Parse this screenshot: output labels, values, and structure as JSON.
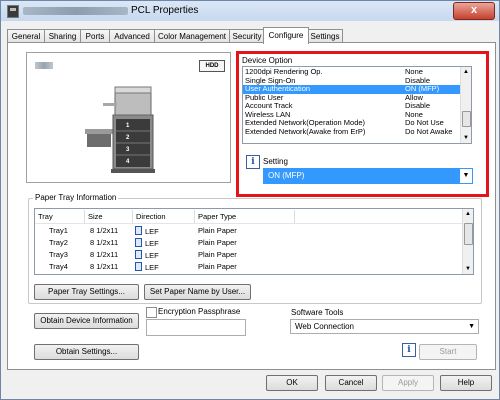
{
  "window": {
    "title": "PCL Properties",
    "close_glyph": "x"
  },
  "tabs": [
    {
      "label": "General"
    },
    {
      "label": "Sharing"
    },
    {
      "label": "Ports"
    },
    {
      "label": "Advanced"
    },
    {
      "label": "Color Management"
    },
    {
      "label": "Security"
    },
    {
      "label": "Configure"
    },
    {
      "label": "Settings"
    }
  ],
  "printer": {
    "hdd_label": "HDD",
    "tray_numbers": [
      "1",
      "2",
      "3",
      "4"
    ]
  },
  "device_option": {
    "title": "Device Option",
    "items": [
      {
        "name": "1200dpi Rendering Op.",
        "value": "None"
      },
      {
        "name": "Single Sign-On",
        "value": "Disable"
      },
      {
        "name": "User Authentication",
        "value": "ON (MFP)",
        "selected": true
      },
      {
        "name": "Public User",
        "value": "Allow"
      },
      {
        "name": "Account Track",
        "value": "Disable"
      },
      {
        "name": "Wireless LAN",
        "value": "None"
      },
      {
        "name": "Extended Network(Operation Mode)",
        "value": "Do Not Use"
      },
      {
        "name": "Extended Network(Awake from ErP)",
        "value": "Do Not Awake"
      }
    ],
    "setting_label": "Setting",
    "setting_value": "ON (MFP)",
    "info_glyph": "i"
  },
  "paper_tray": {
    "title": "Paper Tray Information",
    "columns": [
      "Tray",
      "Size",
      "Direction",
      "Paper Type"
    ],
    "rows": [
      {
        "tray": "Tray1",
        "size": "8 1/2x11",
        "direction": "LEF",
        "type": "Plain Paper"
      },
      {
        "tray": "Tray2",
        "size": "8 1/2x11",
        "direction": "LEF",
        "type": "Plain Paper"
      },
      {
        "tray": "Tray3",
        "size": "8 1/2x11",
        "direction": "LEF",
        "type": "Plain Paper"
      },
      {
        "tray": "Tray4",
        "size": "8 1/2x11",
        "direction": "LEF",
        "type": "Plain Paper"
      }
    ]
  },
  "buttons": {
    "paper_tray_settings": "Paper Tray Settings...",
    "set_paper_name": "Set Paper Name by User...",
    "obtain_device_info": "Obtain Device Information",
    "obtain_settings": "Obtain Settings...",
    "start": "Start",
    "ok": "OK",
    "cancel": "Cancel",
    "apply": "Apply",
    "help": "Help"
  },
  "encryption": {
    "label": "Encryption Passphrase"
  },
  "software_tools": {
    "label": "Software Tools",
    "value": "Web Connection"
  }
}
